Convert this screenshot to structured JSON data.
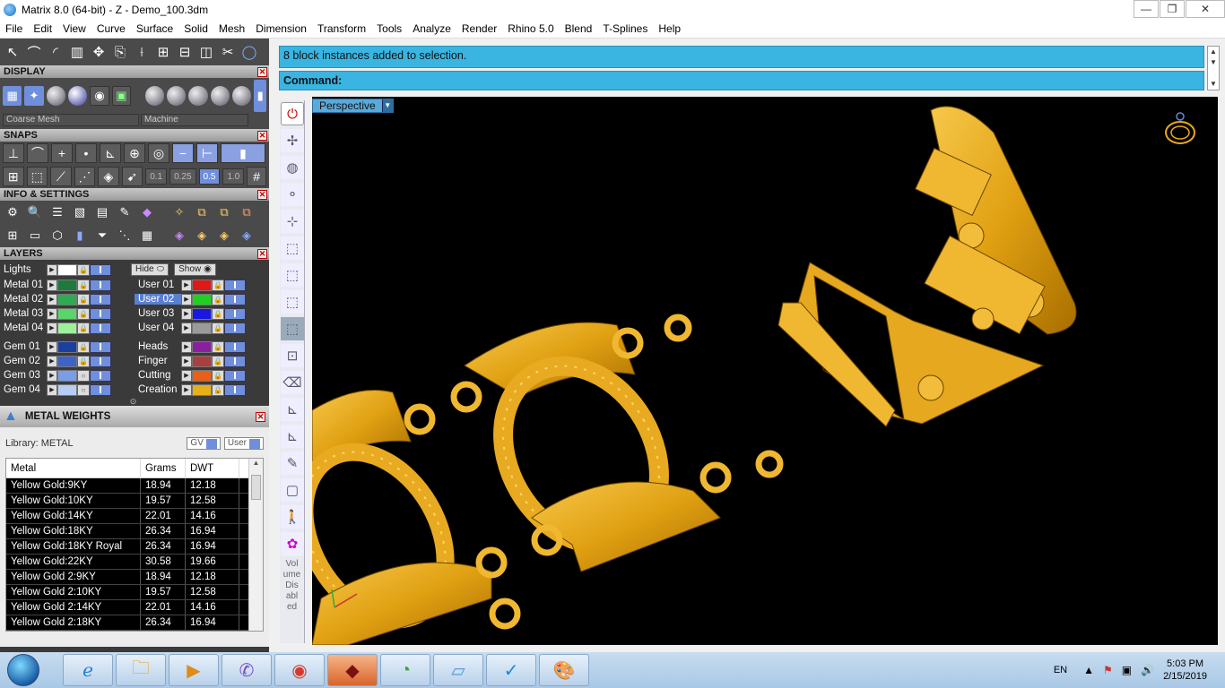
{
  "window": {
    "title": "Matrix 8.0 (64-bit) - Z - Demo_100.3dm",
    "controls": [
      "—",
      "❐",
      "✕"
    ]
  },
  "menu": [
    "File",
    "Edit",
    "View",
    "Curve",
    "Surface",
    "Solid",
    "Mesh",
    "Dimension",
    "Transform",
    "Tools",
    "Analyze",
    "Render",
    "Rhino 5.0",
    "Blend",
    "T-Splines",
    "Help"
  ],
  "panels": {
    "display": {
      "title": "DISPLAY",
      "mesh_select": "Coarse Mesh",
      "material_select": "Machine"
    },
    "snaps": {
      "title": "SNAPS",
      "tolerances": [
        "0.1",
        "0.25",
        "0.5",
        "1.0"
      ],
      "active_tolerance": "0.5"
    },
    "info": {
      "title": "INFO & SETTINGS"
    },
    "layers": {
      "title": "LAYERS",
      "lights_label": "Lights",
      "hide_label": "Hide",
      "show_label": "Show",
      "left": [
        {
          "name": "Metal 01",
          "color": "#1e7a3c"
        },
        {
          "name": "Metal 02",
          "color": "#2eaa50"
        },
        {
          "name": "Metal 03",
          "color": "#5bd46c"
        },
        {
          "name": "Metal 04",
          "color": "#9ff09a"
        },
        {
          "name": "Gem 01",
          "color": "#1b3f9e"
        },
        {
          "name": "Gem 02",
          "color": "#3d63c8"
        },
        {
          "name": "Gem 03",
          "color": "#7a9de6"
        },
        {
          "name": "Gem 04",
          "color": "#b6ccf5"
        }
      ],
      "right": [
        {
          "name": "User 01",
          "color": "#e01818"
        },
        {
          "name": "User 02",
          "color": "#20d020"
        },
        {
          "name": "User 03",
          "color": "#1818e0"
        },
        {
          "name": "User 04",
          "color": "#9a9a9a"
        },
        {
          "name": "Heads",
          "color": "#8a1fa0"
        },
        {
          "name": "Finger",
          "color": "#a84040"
        },
        {
          "name": "Cutting",
          "color": "#e86018"
        },
        {
          "name": "Creation",
          "color": "#e8b018"
        }
      ]
    },
    "metal_weights": {
      "title": "METAL WEIGHTS",
      "library": "Library: METAL",
      "gv_label": "GV",
      "user_label": "User",
      "columns": [
        "Metal",
        "Grams",
        "DWT"
      ],
      "rows": [
        [
          "Yellow Gold:9KY",
          "18.94",
          "12.18"
        ],
        [
          "Yellow Gold:10KY",
          "19.57",
          "12.58"
        ],
        [
          "Yellow Gold:14KY",
          "22.01",
          "14.16"
        ],
        [
          "Yellow Gold:18KY",
          "26.34",
          "16.94"
        ],
        [
          "Yellow Gold:18KY Royal",
          "26.34",
          "16.94"
        ],
        [
          "Yellow Gold:22KY",
          "30.58",
          "19.66"
        ],
        [
          "Yellow Gold 2:9KY",
          "18.94",
          "12.18"
        ],
        [
          "Yellow Gold 2:10KY",
          "19.57",
          "12.58"
        ],
        [
          "Yellow Gold 2:14KY",
          "22.01",
          "14.16"
        ],
        [
          "Yellow Gold 2:18KY",
          "26.34",
          "16.94"
        ]
      ]
    }
  },
  "command": {
    "history": "8 block instances added to selection.",
    "prompt": "Command:"
  },
  "viewport": {
    "label": "Perspective",
    "background": "#000000",
    "metal_color": "#e8a81a"
  },
  "vtool_text": "Vol ume Dis abl ed",
  "taskbar": {
    "lang": "EN",
    "time": "5:03 PM",
    "date": "2/15/2019"
  }
}
